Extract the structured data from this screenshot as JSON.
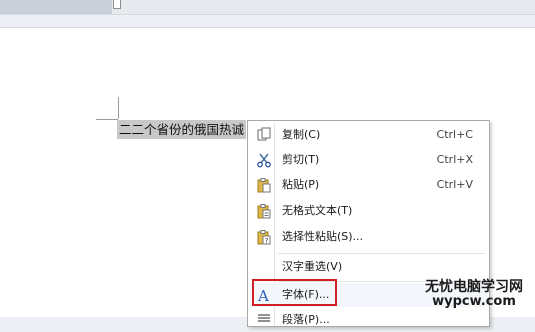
{
  "document": {
    "selected_text": "二二个省份的俄国热诚"
  },
  "context_menu": {
    "items": [
      {
        "label": "复制(C)",
        "shortcut": "Ctrl+C",
        "icon": "copy-icon"
      },
      {
        "label": "剪切(T)",
        "shortcut": "Ctrl+X",
        "icon": "scissors-icon"
      },
      {
        "label": "粘贴(P)",
        "shortcut": "Ctrl+V",
        "icon": "paste-icon"
      },
      {
        "label": "无格式文本(T)",
        "shortcut": "",
        "icon": "paste-plain-icon"
      },
      {
        "label": "选择性粘贴(S)...",
        "shortcut": "",
        "icon": "paste-special-icon"
      },
      {
        "label": "汉字重选(V)",
        "shortcut": "",
        "icon": ""
      },
      {
        "label": "字体(F)...",
        "shortcut": "",
        "icon": "font-icon"
      },
      {
        "label": "段落(P)...",
        "shortcut": "",
        "icon": "paragraph-icon"
      }
    ],
    "highlight_color": "#d21f26"
  },
  "watermark": {
    "line1": "无忧电脑学习网",
    "line2": "wypcw.com"
  }
}
